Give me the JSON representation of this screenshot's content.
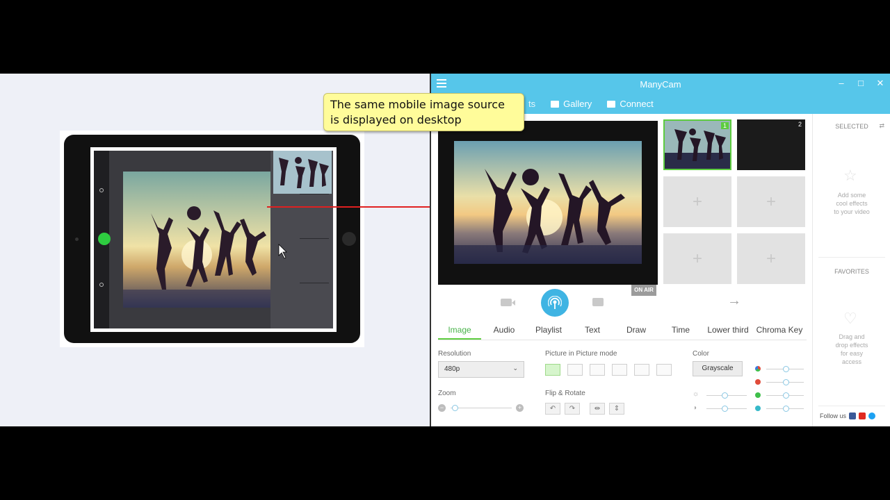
{
  "window": {
    "title": "ManyCam",
    "minimize": "–",
    "maximize": "□",
    "close": "✕"
  },
  "nav": {
    "partial_tab": "ts",
    "gallery": "Gallery",
    "connect": "Connect"
  },
  "callout": {
    "line1": "The same mobile image source",
    "line2": "is displayed on desktop"
  },
  "preview": {
    "on_air": "ON AIR",
    "next": "→"
  },
  "sources": [
    {
      "num": "1",
      "state": "active"
    },
    {
      "num": "2",
      "state": "dark"
    },
    {
      "add": "+"
    },
    {
      "add": "+"
    },
    {
      "add": "+"
    },
    {
      "add": "+"
    }
  ],
  "tabs": [
    "Image",
    "Audio",
    "Playlist",
    "Text",
    "Draw",
    "Time",
    "Lower third",
    "Chroma Key"
  ],
  "active_tab": "Image",
  "image_panel": {
    "resolution_label": "Resolution",
    "resolution_value": "480p",
    "pip_label": "Picture in Picture mode",
    "color_label": "Color",
    "color_value": "Grayscale",
    "zoom_label": "Zoom",
    "zoom_minus": "−",
    "zoom_plus": "+",
    "flip_label": "Flip & Rotate"
  },
  "effects": {
    "selected_header": "SELECTED",
    "selected_text": [
      "Add some",
      "cool effects",
      "to your video"
    ],
    "favorites_header": "FAVORITES",
    "favorites_text": [
      "Drag and",
      "drop effects",
      "for easy",
      "access"
    ],
    "follow_label": "Follow us"
  },
  "colors": {
    "accent_blue": "#56c6ea",
    "accent_green": "#5dcc3f",
    "red_dot": "#e04b3a",
    "green_dot": "#3fbf4a",
    "teal_dot": "#36b9c9"
  }
}
